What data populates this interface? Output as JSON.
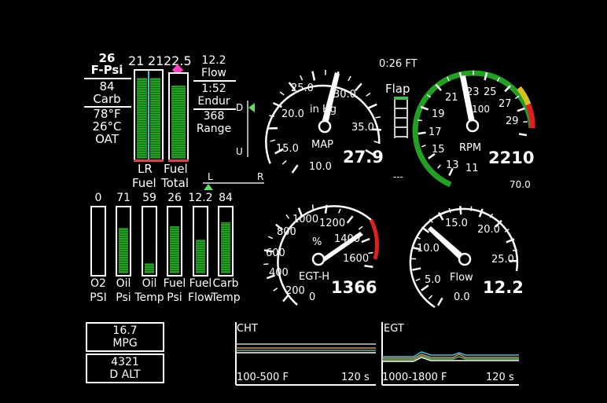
{
  "left_panel": {
    "fuel_psi": {
      "value": "26",
      "label": "F-Psi"
    },
    "carb": {
      "value": "84",
      "label": "Carb"
    },
    "oat": {
      "f": "78°F",
      "c": "26°C",
      "label": "OAT"
    }
  },
  "fuel_bars": {
    "lr_values": [
      "21",
      "21"
    ],
    "total_value": "22.5",
    "lr_label_1": "LR",
    "lr_label_2": "Fuel",
    "total_label_1": "Fuel",
    "total_label_2": "Total",
    "left_fill": 0.94,
    "right_fill": 0.94,
    "total_fill": 0.88
  },
  "flow_panel": {
    "flow_value": "12.2",
    "flow_label": "Flow",
    "endur_value": "1:52",
    "endur_label": "Endur",
    "range_value": "368",
    "range_label": "Range"
  },
  "trim": {
    "d": "D",
    "u": "U",
    "l": "L",
    "r": "R"
  },
  "flap": {
    "time_ft": "0:26 FT",
    "label": "Flap",
    "dashes": "---"
  },
  "small_bars": [
    {
      "value": "0",
      "label1": "O2",
      "label2": "PSI",
      "fill": 0.0
    },
    {
      "value": "71",
      "label1": "Oil",
      "label2": "Psi",
      "fill": 0.72
    },
    {
      "value": "59",
      "label1": "Oil",
      "label2": "Temp",
      "fill": 0.2
    },
    {
      "value": "26",
      "label1": "Fuel",
      "label2": "Psi",
      "fill": 0.75
    },
    {
      "value": "12.2",
      "label1": "Fuel",
      "label2": "Flow",
      "fill": 0.55
    },
    {
      "value": "84",
      "label1": "Carb",
      "label2": "Temp",
      "fill": 0.8
    }
  ],
  "gauges": {
    "map": {
      "ticks": [
        "10.0",
        "15.0",
        "20.0",
        "25.0",
        "30.0",
        "35.0"
      ],
      "unit": "in Hg",
      "label": "MAP",
      "value": "27.9"
    },
    "rpm": {
      "ticks": [
        "11",
        "13",
        "15",
        "17",
        "19",
        "21",
        "23",
        "25",
        "27",
        "29"
      ],
      "unit": "x100",
      "label": "RPM",
      "value": "2210",
      "sub": "70.0"
    },
    "egt": {
      "ticks": [
        "0",
        "200",
        "400",
        "600",
        "800",
        "1000",
        "1200",
        "1400",
        "1600"
      ],
      "unit": "%",
      "label": "EGT-H",
      "value": "1366"
    },
    "flow": {
      "ticks": [
        "0.0",
        "5.0",
        "10.0",
        "15.0",
        "20.0",
        "25.0"
      ],
      "label": "Flow",
      "value": "12.2"
    }
  },
  "info_boxes": {
    "mpg_value": "16.7",
    "mpg_label": "MPG",
    "dalt_value": "4321",
    "dalt_label": "D ALT"
  },
  "trends": {
    "cht": {
      "title": "CHT",
      "range": "100-500 F",
      "time": "120 s"
    },
    "egt": {
      "title": "EGT",
      "range": "1000-1800 F",
      "time": "120 s"
    }
  },
  "colors": {
    "green": "#22a022",
    "yellow": "#d8c020",
    "red": "#e02020",
    "cyan": "#40c0e0",
    "magenta": "#ff40c0"
  }
}
